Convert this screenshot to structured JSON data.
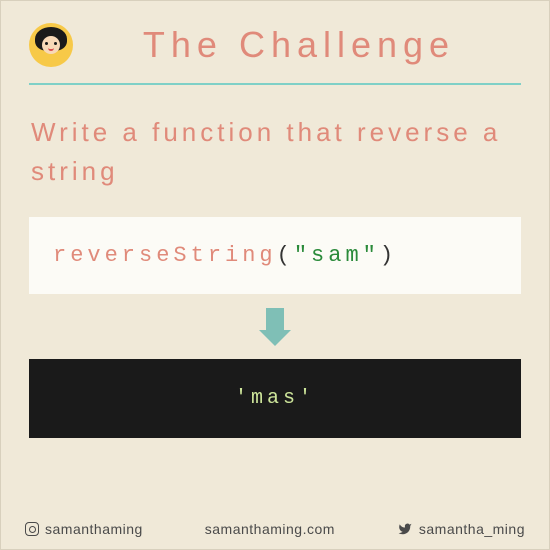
{
  "header": {
    "title": "The Challenge"
  },
  "prompt": "Write a function that reverse a string",
  "code": {
    "fn": "reverseString",
    "open": "(",
    "arg": "\"sam\"",
    "close": ")"
  },
  "output": "'mas'",
  "footer": {
    "instagram": "samanthaming",
    "site": "samanthaming.com",
    "twitter": "samantha_ming"
  },
  "colors": {
    "bg": "#f0e9d8",
    "accent": "#e08a7a",
    "teal": "#7fd0c7",
    "dark": "#1a1a1a"
  }
}
